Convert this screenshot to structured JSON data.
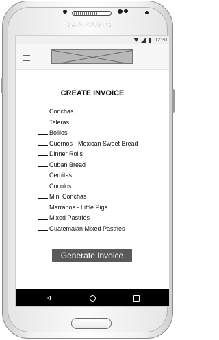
{
  "device": {
    "brand": "SAMSUNG"
  },
  "statusbar": {
    "time": "12:30",
    "icons": [
      "wifi-icon",
      "signal-icon",
      "battery-icon"
    ]
  },
  "appbar": {
    "menu_icon": "hamburger-icon",
    "logo_icon": "image-placeholder-icon"
  },
  "main": {
    "title": "CREATE INVOICE",
    "items": [
      "Conchas",
      "Teleras",
      "Boillos",
      "Cuernos - Mexican Sweet Bread",
      "Dinner Rolls",
      "Cuban Bread",
      "Cemitas",
      "Cocolos",
      "Mini Conchas",
      "Marranos - Little Pigs",
      "Mixed Pastries",
      "Guatemalan Mixed Pastries"
    ],
    "generate_label": "Generate Invoice"
  },
  "navbar": {
    "back_glyph": "◁",
    "home_glyph": "○",
    "recents_glyph": "□"
  },
  "colors": {
    "button_bg": "#5a5a5a",
    "navbar_bg": "#000000",
    "appbar_bg": "#f7f7f7"
  }
}
